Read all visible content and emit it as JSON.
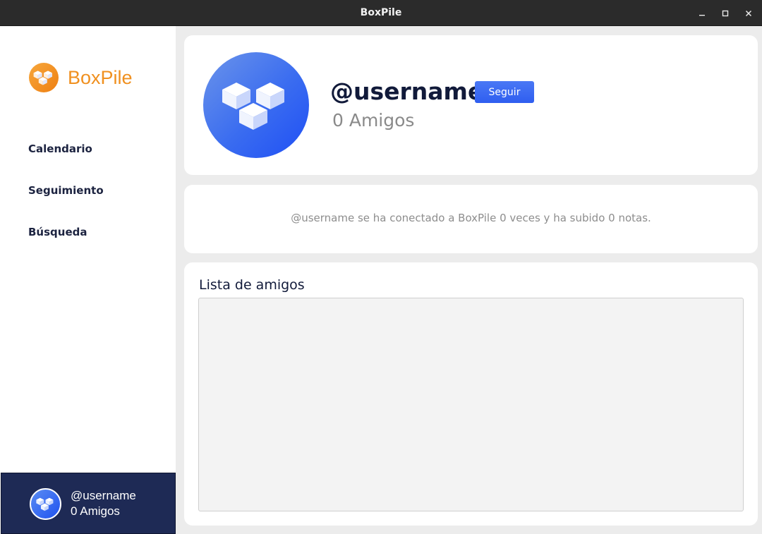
{
  "window": {
    "title": "BoxPile",
    "controls": [
      "minimize-icon",
      "maximize-icon",
      "close-icon"
    ]
  },
  "sidebar": {
    "brand": "BoxPile",
    "nav": [
      {
        "label": "Calendario"
      },
      {
        "label": "Seguimiento"
      },
      {
        "label": "Búsqueda"
      }
    ],
    "user": {
      "username": "@username",
      "friends": "0 Amigos"
    }
  },
  "profile": {
    "username": "@username",
    "follow_label": "Seguir",
    "friends": "0 Amigos"
  },
  "info": {
    "text": "@username se ha conectado a BoxPile 0 veces y ha subido 0 notas."
  },
  "friends_panel": {
    "title": "Lista de amigos",
    "items": []
  },
  "colors": {
    "brand": "#f0901f",
    "accent": "#3563f2",
    "user_card": "#1e2a55"
  }
}
